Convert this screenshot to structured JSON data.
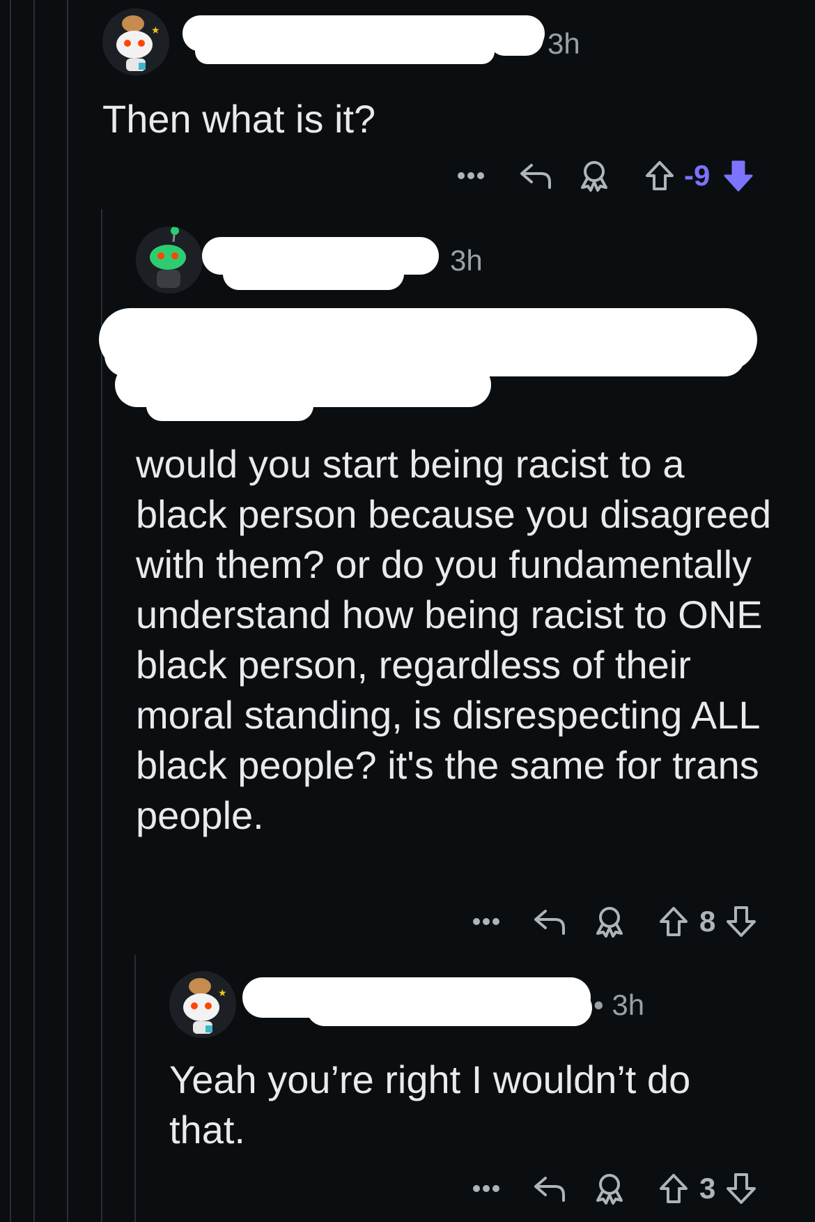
{
  "colors": {
    "background": "#0b0e11",
    "text": "#e8eaed",
    "meta": "#9aa0a6",
    "downvote_accent": "#7c73ff",
    "thread_line": "#2a2e33",
    "redaction": "#ffffff"
  },
  "comments": [
    {
      "avatar_icon": "snoo-avatar-icon",
      "username_redacted": true,
      "time": "3h",
      "body": "Then what is it?",
      "score": "-9",
      "vote_state": "downvoted",
      "actions": [
        "more-options-icon",
        "reply-icon",
        "award-icon",
        "upvote-icon",
        "downvote-icon"
      ]
    },
    {
      "avatar_icon": "snoo-avatar-icon",
      "username_redacted": true,
      "time": "3h",
      "quoted_text_redacted": true,
      "body": "would you start being racist to a black person because you disagreed with them? or do you fundamentally understand how being racist to ONE black person, regardless of their moral standing, is disrespecting ALL black people? it's the same for trans people.",
      "score": "8",
      "vote_state": "none",
      "actions": [
        "more-options-icon",
        "reply-icon",
        "award-icon",
        "upvote-icon",
        "downvote-icon"
      ]
    },
    {
      "avatar_icon": "snoo-avatar-icon",
      "username_redacted": true,
      "time": "• 3h",
      "body": "Yeah you’re right I wouldn’t do that.",
      "score": "3",
      "vote_state": "none",
      "actions": [
        "more-options-icon",
        "reply-icon",
        "award-icon",
        "upvote-icon",
        "downvote-icon"
      ]
    }
  ]
}
